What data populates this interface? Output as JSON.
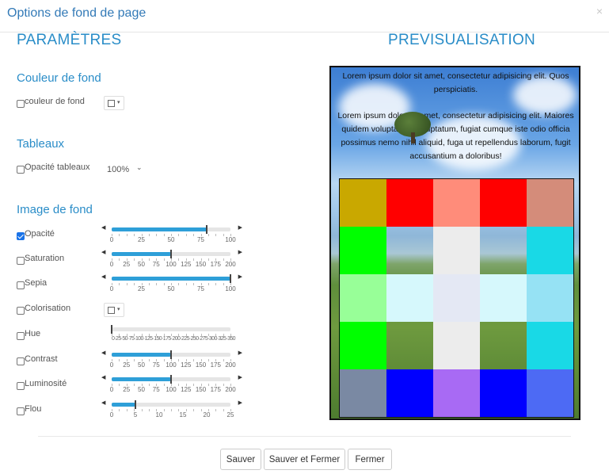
{
  "window": {
    "title": "Options de fond de page",
    "close": "×"
  },
  "headings": {
    "params": "PARAMÈTRES",
    "preview": "PREVISUALISATION"
  },
  "sections": {
    "background_color": "Couleur de fond",
    "tables": "Tableaux",
    "background_image": "Image de fond"
  },
  "controls": {
    "bg_color": {
      "label": "couleur de fond",
      "checked": false,
      "caret": "▾"
    },
    "table_opacity": {
      "label": "Opacité tableaux",
      "checked": false,
      "value": "100%",
      "chevron": "⌄"
    },
    "opacity": {
      "label": "Opacité",
      "checked": true,
      "value": 80,
      "min": 0,
      "max": 100,
      "ticks": [
        "0",
        "25",
        "50",
        "75",
        "100"
      ]
    },
    "saturation": {
      "label": "Saturation",
      "checked": false,
      "value": 100,
      "min": 0,
      "max": 200,
      "ticks": [
        "0",
        "25",
        "50",
        "75",
        "100",
        "125",
        "150",
        "175",
        "200"
      ]
    },
    "sepia": {
      "label": "Sepia",
      "checked": false,
      "value": 100,
      "min": 0,
      "max": 100,
      "ticks": [
        "0",
        "25",
        "50",
        "75",
        "100"
      ]
    },
    "colorisation": {
      "label": "Colorisation",
      "checked": false,
      "caret": "▾"
    },
    "hue": {
      "label": "Hue",
      "checked": false,
      "value": 0,
      "min": 0,
      "max": 360,
      "ticks_text": "0·25·50·75·100·125·150·175·200·225·250·275·300·325·350"
    },
    "contrast": {
      "label": "Contrast",
      "checked": false,
      "value": 100,
      "min": 0,
      "max": 200,
      "ticks": [
        "0",
        "25",
        "50",
        "75",
        "100",
        "125",
        "150",
        "175",
        "200"
      ]
    },
    "luminosity": {
      "label": "Luminosité",
      "checked": false,
      "value": 100,
      "min": 0,
      "max": 200,
      "ticks": [
        "0",
        "25",
        "50",
        "75",
        "100",
        "125",
        "150",
        "175",
        "200"
      ]
    },
    "blur": {
      "label": "Flou",
      "checked": false,
      "value": 5,
      "min": 0,
      "max": 25,
      "ticks": [
        "0",
        "5",
        "10",
        "15",
        "20",
        "25"
      ]
    }
  },
  "preview": {
    "para1": "Lorem ipsum dolor sit amet, consectetur adipisicing elit. Quos perspiciatis.",
    "para2": "Lorem ipsum dolor sit amet, consectetur adipisicing elit. Maiores quidem voluptas sit voluptatum, fugiat cumque iste odio officia possimus nemo nihil aliquid, fuga ut repellendus laborum, fugit accusantium a doloribus!",
    "table_colors": [
      [
        "#c9a800",
        "#ff0000",
        "#ff8c7a",
        "#ff0000",
        "#d48c7a"
      ],
      [
        "#00ff00",
        "transparent",
        "#ececec",
        "transparent",
        "#19d9e6"
      ],
      [
        "#98ff98",
        "#d6f8fc",
        "#e4e8f4",
        "#d6f8fc",
        "#96e2f4"
      ],
      [
        "#00ff00",
        "transparent",
        "#ececec",
        "transparent",
        "#19d9e6"
      ],
      [
        "#7a89a3",
        "#0000ff",
        "#a86af4",
        "#0000ff",
        "#4d6af4"
      ]
    ]
  },
  "buttons": {
    "save": "Sauver",
    "save_close": "Sauver et Fermer",
    "close": "Fermer"
  }
}
